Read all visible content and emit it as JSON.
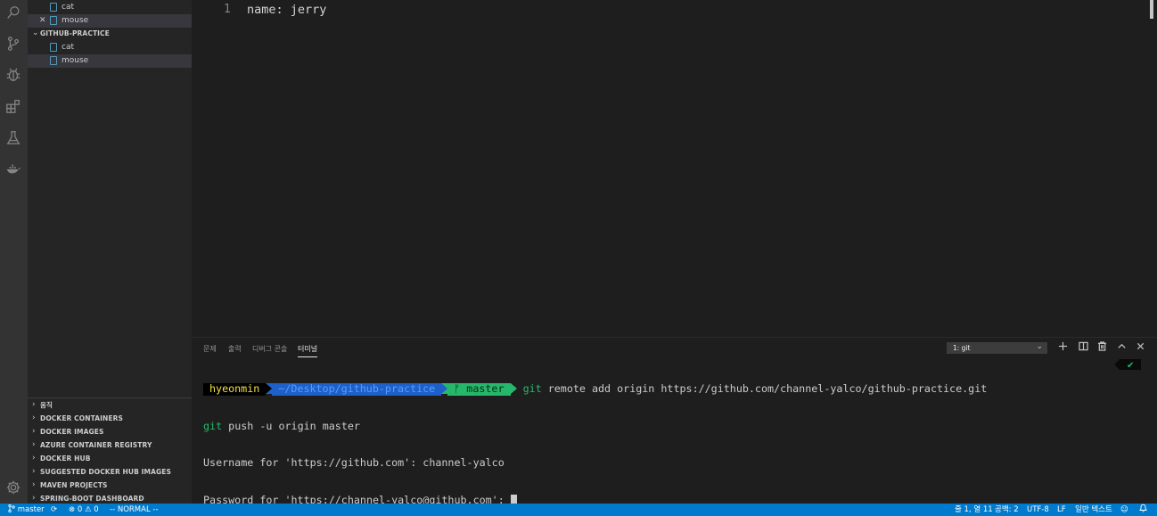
{
  "sidebar": {
    "open_editors": [
      {
        "label": "cat"
      },
      {
        "label": "mouse"
      }
    ],
    "folder": {
      "label": "GITHUB-PRACTICE",
      "files": [
        {
          "label": "cat"
        },
        {
          "label": "mouse"
        }
      ]
    },
    "sections": [
      {
        "label": "움직"
      },
      {
        "label": "DOCKER CONTAINERS"
      },
      {
        "label": "DOCKER IMAGES"
      },
      {
        "label": "AZURE CONTAINER REGISTRY"
      },
      {
        "label": "DOCKER HUB"
      },
      {
        "label": "SUGGESTED DOCKER HUB IMAGES"
      },
      {
        "label": "MAVEN PROJECTS"
      },
      {
        "label": "SPRING-BOOT DASHBOARD"
      }
    ]
  },
  "editor": {
    "line_number": "1",
    "code": "name: jerry"
  },
  "panel": {
    "tabs": [
      "문제",
      "출력",
      "디버그 콘솔",
      "터미널"
    ],
    "active_tab": "터미널",
    "terminal_select": "1: git",
    "prompt": {
      "user": "hyeonmin",
      "path": "~/Desktop/github-practice",
      "branch": "master",
      "branch_glyph": "ᚠ"
    },
    "lines": [
      {
        "cmd": "git",
        "rest": " remote add origin https://github.com/channel-yalco/github-practice.git"
      },
      {
        "cmd": "git",
        "rest": " push -u origin master"
      },
      {
        "text": "Username for 'https://github.com': channel-yalco"
      },
      {
        "text": "Password for 'https://channel-yalco@github.com': "
      }
    ],
    "check": "✔"
  },
  "statusbar": {
    "branch": "master",
    "errors": "0",
    "warnings": "0",
    "mode": "-- NORMAL --",
    "position": "줄 1, 열 11",
    "spaces": "공백: 2",
    "encoding": "UTF-8",
    "eol": "LF",
    "language": "일반 텍스트"
  },
  "colors": {
    "statusbar": "#007acc",
    "activity_bar": "#333333",
    "sidebar": "#252526",
    "editor": "#1e1e1e"
  }
}
